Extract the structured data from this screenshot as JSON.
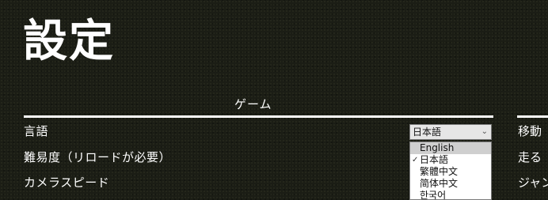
{
  "title": "設定",
  "section": {
    "label": "ゲーム"
  },
  "rows": [
    {
      "label": "言語"
    },
    {
      "label": "難易度（リロードが必要）"
    },
    {
      "label": "カメラスピード"
    }
  ],
  "side_rows": [
    {
      "label": "移動"
    },
    {
      "label": "走る"
    },
    {
      "label": "ジャン"
    }
  ],
  "language_select": {
    "selected": "日本語",
    "options": [
      "English",
      "日本語",
      "繁體中文",
      "简体中文",
      "한국어"
    ],
    "highlighted": "English"
  }
}
